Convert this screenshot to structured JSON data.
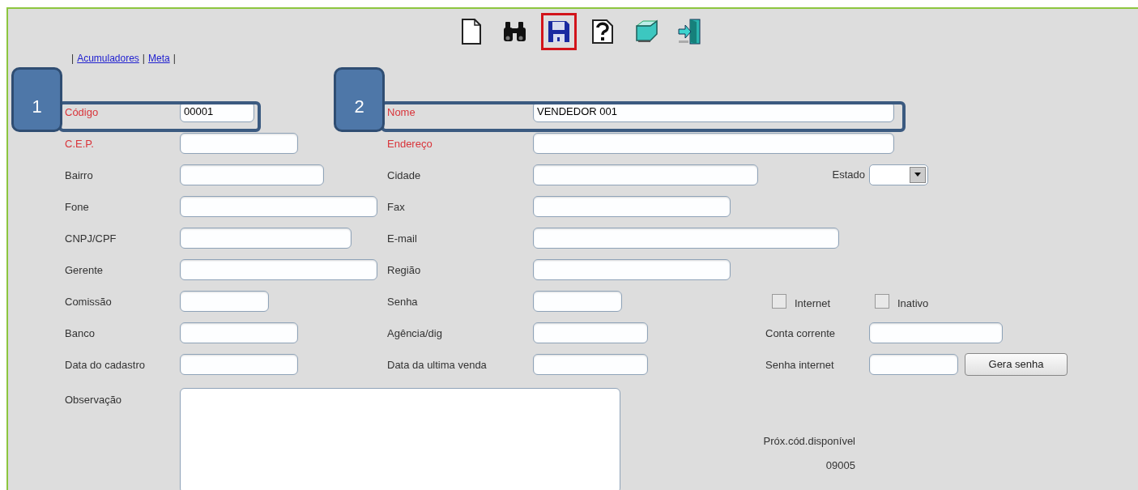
{
  "toolbar": [
    {
      "kind": "new",
      "selected": false
    },
    {
      "kind": "search",
      "selected": false
    },
    {
      "kind": "save",
      "selected": true
    },
    {
      "kind": "help",
      "selected": false
    },
    {
      "kind": "edit",
      "selected": false
    },
    {
      "kind": "exit",
      "selected": false
    }
  ],
  "links_bar": {
    "separator": "|",
    "links": [
      "Acumuladores",
      "Meta"
    ]
  },
  "callouts": [
    {
      "number": "1"
    },
    {
      "number": "2"
    }
  ],
  "rows": [
    {
      "fields": [
        {
          "kind": "text",
          "label": "Código",
          "required": true,
          "value": "00001"
        },
        {
          "kind": "text",
          "label": "Nome",
          "required": true,
          "value": "VENDEDOR 001"
        }
      ]
    },
    {
      "fields": [
        {
          "kind": "text",
          "label": "C.E.P.",
          "required": true
        },
        {
          "kind": "text",
          "label": "Endereço",
          "required": true
        }
      ]
    },
    {
      "fields": [
        {
          "kind": "text",
          "label": "Bairro",
          "required": false
        },
        {
          "kind": "text",
          "label": "Cidade",
          "required": false
        },
        {
          "kind": "select",
          "label": "Estado",
          "required": false
        }
      ]
    },
    {
      "fields": [
        {
          "kind": "text",
          "label": "Fone",
          "required": false
        },
        {
          "kind": "text",
          "label": "Fax",
          "required": false
        }
      ]
    },
    {
      "fields": [
        {
          "kind": "text",
          "label": "CNPJ/CPF",
          "required": false
        },
        {
          "kind": "text",
          "label": "E-mail",
          "required": false
        }
      ]
    },
    {
      "fields": [
        {
          "kind": "text",
          "label": "Gerente",
          "required": false
        },
        {
          "kind": "text",
          "label": "Região",
          "required": false
        }
      ]
    },
    {
      "fields": [
        {
          "kind": "text",
          "label": "Comissão",
          "required": false
        },
        {
          "kind": "text",
          "label": "Senha",
          "required": false
        },
        {
          "kind": "checkboxes",
          "items": [
            {
              "label": "Internet",
              "checked": false
            },
            {
              "label": "Inativo",
              "checked": false
            }
          ]
        }
      ]
    },
    {
      "fields": [
        {
          "kind": "text",
          "label": "Banco",
          "required": false
        },
        {
          "kind": "text",
          "label": "Agência/dig",
          "required": false
        },
        {
          "kind": "text",
          "label": "Conta corrente",
          "required": false
        }
      ]
    },
    {
      "fields": [
        {
          "kind": "text",
          "label": "Data do cadastro",
          "required": false
        },
        {
          "kind": "text",
          "label": "Data da ultima venda",
          "required": false
        },
        {
          "kind": "password_gen",
          "label": "Senha internet",
          "required": false,
          "button": "Gera senha"
        }
      ]
    }
  ],
  "observacao": {
    "label": "Observação"
  },
  "next_code": {
    "label": "Próx.cód.disponível",
    "value": "09005"
  }
}
